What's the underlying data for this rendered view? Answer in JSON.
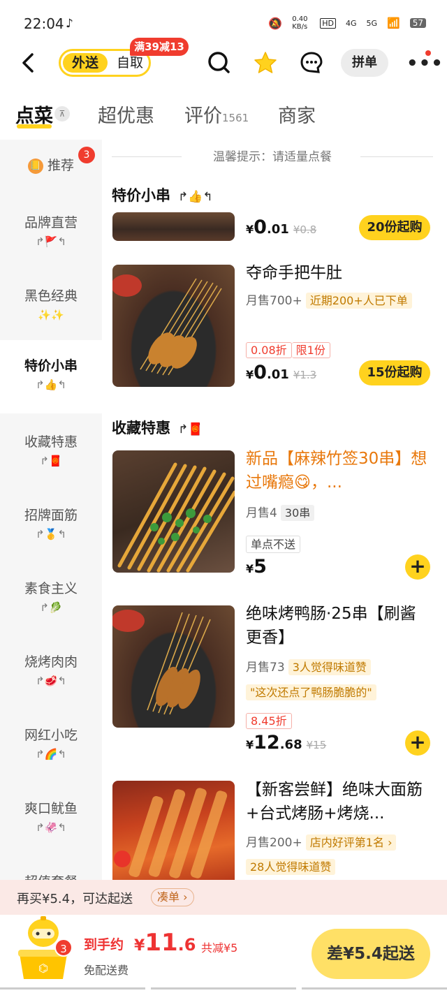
{
  "status": {
    "time": "22:04",
    "net_speed": "0.40 KB/s",
    "signal1": "4G",
    "signal2": "5G",
    "battery": "57"
  },
  "header": {
    "delivery_label": "外送",
    "pickup_label": "自取",
    "promo_badge": "满39减13",
    "group_order_label": "拼单",
    "more_label": "•••"
  },
  "tabs": [
    {
      "label": "点菜"
    },
    {
      "label": "超优惠"
    },
    {
      "label": "评价"
    },
    {
      "label": "商家"
    }
  ],
  "review_count": "1561",
  "sidebar": {
    "items": [
      {
        "label": "推荐",
        "emoji": ""
      },
      {
        "label": "品牌直营",
        "emoji": "↱🚩↰"
      },
      {
        "label": "黑色经典",
        "emoji": "✨✨"
      },
      {
        "label": "特价小串",
        "emoji": "↱👍↰"
      },
      {
        "label": "收藏特惠",
        "emoji": "↱🧧"
      },
      {
        "label": "招牌面筋",
        "emoji": "↱🥇↰"
      },
      {
        "label": "素食主义",
        "emoji": "↱🥬"
      },
      {
        "label": "烧烤肉肉",
        "emoji": "↱🥩↰"
      },
      {
        "label": "网红小吃",
        "emoji": "↱🌈↰"
      },
      {
        "label": "爽口鱿鱼",
        "emoji": "↱🦑↰"
      },
      {
        "label": "超值套餐",
        "emoji": ""
      }
    ],
    "recommend_badge": "3"
  },
  "hint": "温馨提示：请适量点餐",
  "sections": {
    "special": {
      "title": "特价小串",
      "emoji": "↱👍↰"
    },
    "collect": {
      "title": "收藏特惠",
      "emoji": "↱🧧"
    }
  },
  "products": {
    "p0": {
      "price_cur": "¥",
      "price_int": "0",
      "price_dec": ".01",
      "orig": "¥0.8",
      "min_order": "20份起购"
    },
    "p1": {
      "name": "夺命手把牛肚",
      "sales": "月售700+",
      "tag": "近期200+人已下单",
      "discount": "0.08折",
      "limit": "限1份",
      "price_cur": "¥",
      "price_int": "0",
      "price_dec": ".01",
      "orig": "¥1.3",
      "min_order": "15份起购"
    },
    "p2": {
      "name": "新品【麻辣竹签30串】想过嘴瘾😋，...",
      "sales": "月售4",
      "tag": "30串",
      "note": "单点不送",
      "price_cur": "¥",
      "price_int": "5",
      "price_dec": "",
      "add": "+"
    },
    "p3": {
      "name": "绝味烤鸭肠·25串【刷酱更香】",
      "sales": "月售73",
      "tag": "3人觉得味道赞",
      "quote": "\"这次还点了鸭肠脆脆的\"",
      "discount": "8.45折",
      "price_cur": "¥",
      "price_int": "12",
      "price_dec": ".68",
      "orig": "¥15",
      "add": "+"
    },
    "p4": {
      "name": "【新客尝鲜】绝味大面筋+台式烤肠+烤烧...",
      "sales": "月售200+",
      "tag": "店内好评第1名 ›",
      "tag2": "28人觉得味道赞"
    }
  },
  "cart": {
    "topline": "再买¥5.4，可达起送",
    "top_button": "凑单 ›",
    "badge": "3",
    "arrive_label": "到手约",
    "arrive_cur": "¥",
    "arrive_int": "11",
    "arrive_dec": ".6",
    "savings": "共减¥5",
    "free_delivery": "免配送费",
    "checkout": "差¥5.4起送"
  },
  "colors": {
    "accent": "#ffd21e",
    "red": "#f03c2e",
    "orange": "#e8780c"
  }
}
